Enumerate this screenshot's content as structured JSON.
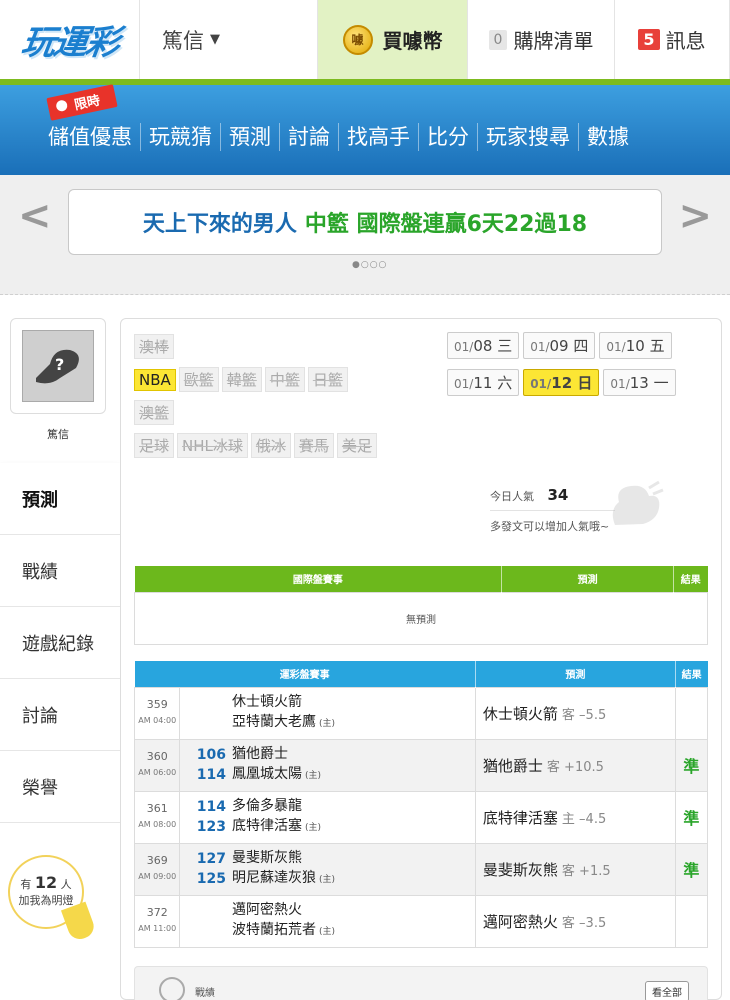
{
  "header": {
    "logo": "玩運彩",
    "user": "篤信",
    "buy_label": "買噱幣",
    "coin_glyph": "噱",
    "cart_count": "0",
    "cart_label": "購牌清單",
    "msg_count": "5",
    "msg_label": "訊息"
  },
  "nav": {
    "promo": "限時",
    "items": [
      "儲值優惠",
      "玩競猜",
      "預測",
      "討論",
      "找高手",
      "比分",
      "玩家搜尋",
      "數據"
    ]
  },
  "banner": {
    "text_a": "天上下來的男人",
    "text_b": "中籃 國際盤連贏6天22過18"
  },
  "profile": {
    "name": "篤信",
    "menu": [
      "預測",
      "戰績",
      "遊戲紀錄",
      "討論",
      "榮譽"
    ],
    "fans_prefix": "有",
    "fans_count": "12",
    "fans_suffix": "人",
    "fans_note": "加我為明燈"
  },
  "leagues": {
    "row1": [
      "澳棒"
    ],
    "row2": [
      "NBA",
      "歐籃",
      "韓籃",
      "中籃",
      "日籃"
    ],
    "row3": [
      "澳籃"
    ],
    "row4": [
      "足球",
      "NHL冰球",
      "俄冰",
      "賽馬",
      "美足"
    ],
    "active": "NBA"
  },
  "dates": [
    {
      "m": "01/",
      "d": "08",
      "w": "三"
    },
    {
      "m": "01/",
      "d": "09",
      "w": "四"
    },
    {
      "m": "01/",
      "d": "10",
      "w": "五"
    },
    {
      "m": "01/",
      "d": "11",
      "w": "六"
    },
    {
      "m": "01/",
      "d": "12",
      "w": "日"
    },
    {
      "m": "01/",
      "d": "13",
      "w": "一"
    }
  ],
  "popularity": {
    "label": "今日人氣",
    "value": "34",
    "note": "多發文可以增加人氣哦~"
  },
  "intl_table": {
    "headers": [
      "國際盤賽事",
      "預測",
      "結果"
    ],
    "empty": "無預測"
  },
  "lottery_table": {
    "headers": [
      "運彩盤賽事",
      "預測",
      "結果"
    ],
    "rows": [
      {
        "num": "359",
        "time": "AM 04:00",
        "away_score": "",
        "home_score": "",
        "away": "休士頓火箭",
        "home": "亞特蘭大老鷹",
        "home_mark": "(主)",
        "pick": "休士頓火箭",
        "side": "客",
        "line": "–5.5",
        "result": ""
      },
      {
        "num": "360",
        "time": "AM 06:00",
        "away_score": "106",
        "home_score": "114",
        "away": "猶他爵士",
        "home": "鳳凰城太陽",
        "home_mark": "(主)",
        "pick": "猶他爵士",
        "side": "客",
        "line": "+10.5",
        "result": "準"
      },
      {
        "num": "361",
        "time": "AM 08:00",
        "away_score": "114",
        "home_score": "123",
        "away": "多倫多暴龍",
        "home": "底特律活塞",
        "home_mark": "(主)",
        "pick": "底特律活塞",
        "side": "主",
        "line": "–4.5",
        "result": "準"
      },
      {
        "num": "369",
        "time": "AM 09:00",
        "away_score": "127",
        "home_score": "125",
        "away": "曼斐斯灰熊",
        "home": "明尼蘇達灰狼",
        "home_mark": "(主)",
        "pick": "曼斐斯灰熊",
        "side": "客",
        "line": "+1.5",
        "result": "準"
      },
      {
        "num": "372",
        "time": "AM 11:00",
        "away_score": "",
        "home_score": "",
        "away": "邁阿密熱火",
        "home": "波特蘭拓荒者",
        "home_mark": "(主)",
        "pick": "邁阿密熱火",
        "side": "客",
        "line": "–3.5",
        "result": ""
      }
    ]
  },
  "bottom": {
    "label": "戰績",
    "view_all": "看全部"
  },
  "colors": {
    "brand_green": "#7dbb1f",
    "nav_blue": "#1a6fb8",
    "active_yellow": "#fce634",
    "result_green": "#2aa52a"
  }
}
